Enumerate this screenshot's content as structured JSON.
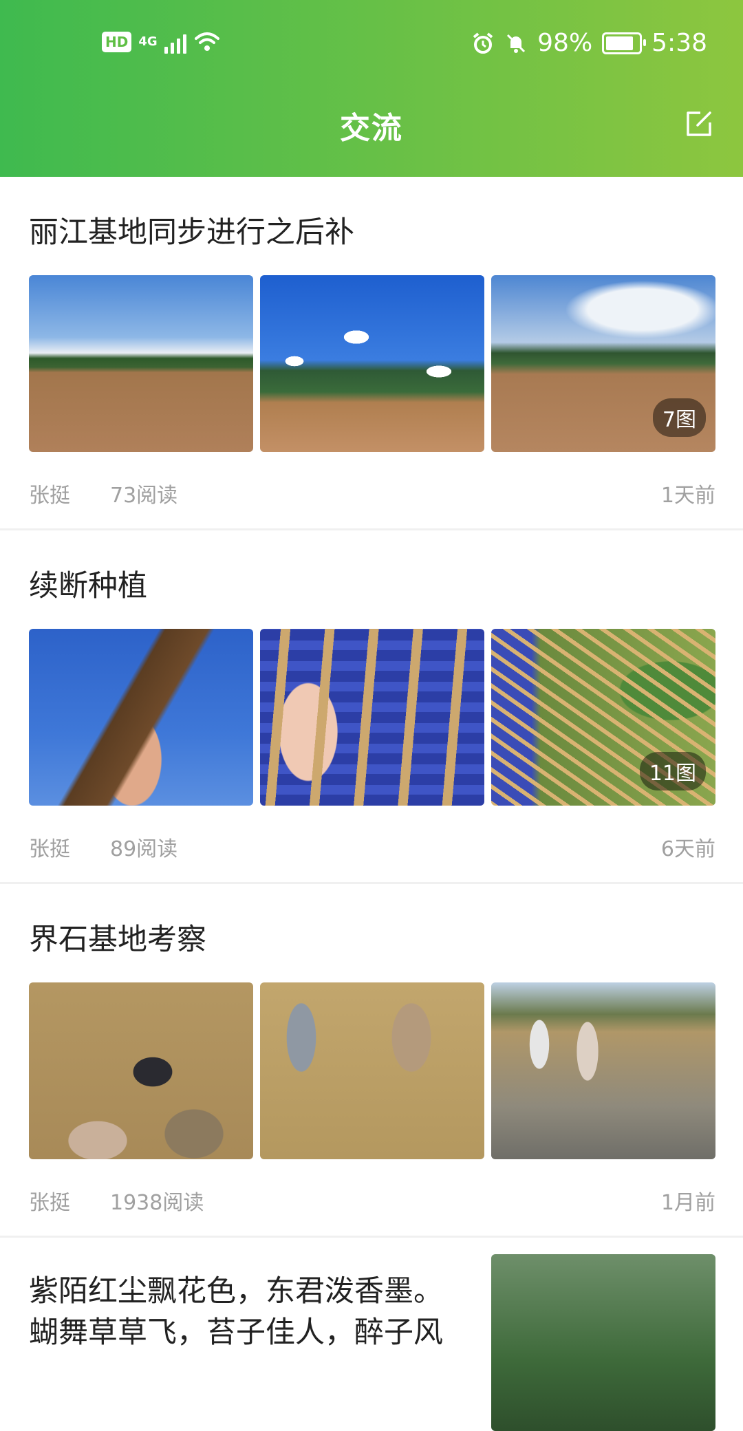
{
  "status_bar": {
    "network_badge": "HD",
    "network_type": "4G",
    "battery_percent": "98%",
    "battery_level": 0.98,
    "time": "5:38"
  },
  "header": {
    "title": "交流",
    "edit_icon": "edit-icon"
  },
  "posts": [
    {
      "title": "丽江基地同步进行之后补",
      "image_count": "7图",
      "author": "张挺",
      "reads": "73阅读",
      "time": "1天前"
    },
    {
      "title": "续断种植",
      "image_count": "11图",
      "author": "张挺",
      "reads": "89阅读",
      "time": "6天前"
    },
    {
      "title": "界石基地考察",
      "author": "张挺",
      "reads": "1938阅读",
      "time": "1月前"
    },
    {
      "title": "紫陌红尘飘花色，东君泼香墨。蝴舞草草飞，苔子佳人，醉子风"
    }
  ]
}
